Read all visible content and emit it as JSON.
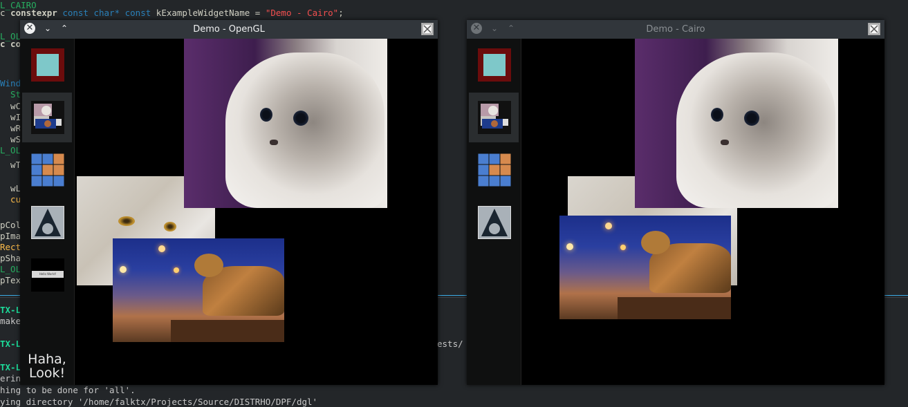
{
  "editor": {
    "lines": [
      {
        "pre": "L_CAIRO",
        "cls": "grn"
      },
      {
        "pre": "c ",
        "kw": "constexpr",
        "kt1": " const char* const ",
        "rest": "kExampleWidgetName = ",
        "str": "\"Demo - Cairo\"",
        "end": ";"
      },
      {
        "pre": "L_OL",
        "cls": "grn"
      },
      {
        "pre": "c co",
        "cls": "kw"
      },
      {
        "pre": "Windo",
        "cls": "kt"
      },
      {
        "pre": "  Sta",
        "cls": "grn"
      },
      {
        "pre": "  wCo",
        "cls": ""
      },
      {
        "pre": "  wIn",
        "cls": ""
      },
      {
        "pre": "  wRe",
        "cls": ""
      },
      {
        "pre": "  wSh",
        "cls": ""
      },
      {
        "pre": "L_OL",
        "cls": "grn"
      },
      {
        "pre": "  wTe",
        "cls": ""
      },
      {
        "pre": "  wLo",
        "cls": ""
      },
      {
        "pre": "  cu",
        "cls": "yel"
      },
      {
        "pre": "pColo",
        "cls": ""
      },
      {
        "pre": "pImag",
        "cls": ""
      },
      {
        "pre": "Recta",
        "cls": "yel"
      },
      {
        "pre": "pShap",
        "cls": ""
      },
      {
        "pre": "L_OL",
        "cls": "grn"
      },
      {
        "pre": "pText",
        "cls": ""
      }
    ]
  },
  "terminal": {
    "lines": [
      {
        "text": "TX-L",
        "green": true
      },
      {
        "text": "make",
        "green": false
      },
      {
        "text": "TX-L",
        "green": true
      },
      {
        "text": "TX-L",
        "green": true
      },
      {
        "text": "ering",
        "green": false
      },
      {
        "text": "hing to be done for 'all'.",
        "green": false
      },
      {
        "text": "ying directory '/home/falktx/Projects/Source/DISTRHO/DPF/dgl'",
        "green": false
      }
    ],
    "partial_right": "ests/"
  },
  "windows": [
    {
      "title": "Demo - OpenGL",
      "active": true,
      "close_glyph": "✕",
      "min_glyph": "⌄",
      "max_glyph": "⌃",
      "sidebar": [
        {
          "name": "color-widget",
          "active": false
        },
        {
          "name": "image-widget",
          "active": true
        },
        {
          "name": "rectangles-widget",
          "active": false
        },
        {
          "name": "shapes-widget",
          "active": false
        },
        {
          "name": "button-widget",
          "active": false,
          "button_text": "Hello World!"
        },
        {
          "name": "text-widget",
          "active": false
        }
      ],
      "text_label": "Haha,\nLook!"
    },
    {
      "title": "Demo - Cairo",
      "active": false,
      "close_glyph": "✕",
      "min_glyph": "⌄",
      "max_glyph": "⌃",
      "sidebar": [
        {
          "name": "color-widget",
          "active": false
        },
        {
          "name": "image-widget",
          "active": true
        },
        {
          "name": "rectangles-widget",
          "active": false
        },
        {
          "name": "shapes-widget",
          "active": false
        }
      ]
    }
  ],
  "colors": {
    "accent": "#3daee9",
    "titlebar": "#31363b",
    "color_widget_outer": "#6b0c0c",
    "color_widget_inner": "#7ec8c9",
    "rect_blue": "#4a7ed0",
    "rect_orange": "#d68a4e",
    "shape_bg": "#a9b1b8"
  }
}
